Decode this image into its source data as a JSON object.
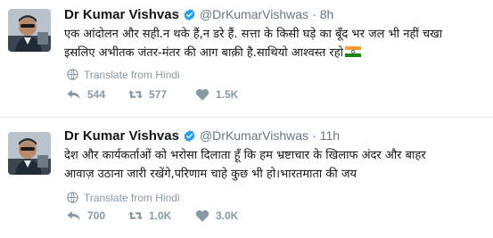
{
  "colors": {
    "verified": "#1da1f2",
    "text": "#14171a",
    "muted": "#657786",
    "action_muted": "#8899a6"
  },
  "tweets": [
    {
      "name": "Dr Kumar Vishvas",
      "handle": "@DrKumarVishwas",
      "separator": "·",
      "time": "8h",
      "line1": "एक आंदोलन और सही.न थके हैं,न डरे हैं. सत्ता के किसी घड़े का बूँद भर जल भी नहीं चखा",
      "line2": "इसलिए अभीतक जंतर-मंतर की आग बाक़ी है.साथियो आश्वस्त रहो",
      "translate": "Translate from Hindi",
      "replies": "544",
      "retweets": "577",
      "likes": "1.5K",
      "icons": [
        "verified-badge",
        "india-flag-emoji",
        "globe-icon",
        "reply-icon",
        "retweet-icon",
        "heart-icon"
      ]
    },
    {
      "name": "Dr Kumar Vishvas",
      "handle": "@DrKumarVishwas",
      "separator": "·",
      "time": "11h",
      "line1": "देश और कार्यकर्ताओं को भरोसा दिलाता हूँ कि हम  भ्रष्टाचार के खिलाफ अंदर और बाहर",
      "line2": "आवाज़ उठाना जारी रखेंगे,परिणाम चाहे कुछ भी हो।भारतमाता की जय",
      "translate": "Translate from Hindi",
      "replies": "700",
      "retweets": "1.0K",
      "likes": "3.0K",
      "icons": [
        "verified-badge",
        "globe-icon",
        "reply-icon",
        "retweet-icon",
        "heart-icon"
      ]
    }
  ]
}
